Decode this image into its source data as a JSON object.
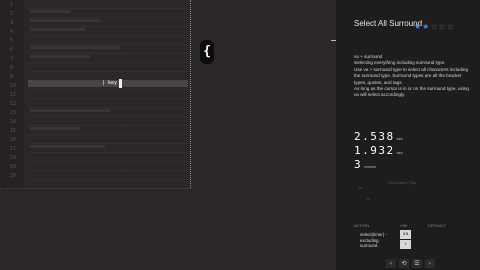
{
  "editor": {
    "line_numbers": [
      "1",
      "2",
      "3",
      "4",
      "5",
      "6",
      "7",
      "8",
      "9",
      "10",
      "11",
      "12",
      "13",
      "14",
      "15",
      "16",
      "17",
      "18",
      "19",
      "20"
    ],
    "highlight_text": "| key",
    "brace_glyph": "{"
  },
  "panel": {
    "title": "Select All Surround",
    "rating": {
      "stars_filled": 2,
      "stars_total": 5,
      "filled_glyph": "★",
      "empty_glyph": "☆"
    },
    "description": [
      "va + surround",
      "Selecting everything including surround type.",
      "Use va + surround type to select all characters including the surround type. Surround types are all the bracket types, quotes, and tags.",
      "As long as the cursor is in or on the surround type, using va will select accordingly."
    ],
    "stats": [
      {
        "value": "2.538",
        "unit": "sec"
      },
      {
        "value": "1.932",
        "unit": "sec"
      },
      {
        "value": "3",
        "unit": "moves"
      }
    ],
    "faint_label": "Associated Tips",
    "faint_a": "va",
    "faint_b": "va",
    "table_headers": {
      "action": "ACTION",
      "vim": "VIM",
      "default": "DEFAULT"
    },
    "action_text": "select(timer) - excluding surround",
    "keys": [
      "va",
      "⇧"
    ],
    "nav": [
      "‹",
      "⟲",
      "☰",
      "›"
    ]
  },
  "colors": {
    "accent": "#3b8fe0",
    "panel_bg": "#1e1c1c",
    "editor_bg": "#2b2727"
  }
}
